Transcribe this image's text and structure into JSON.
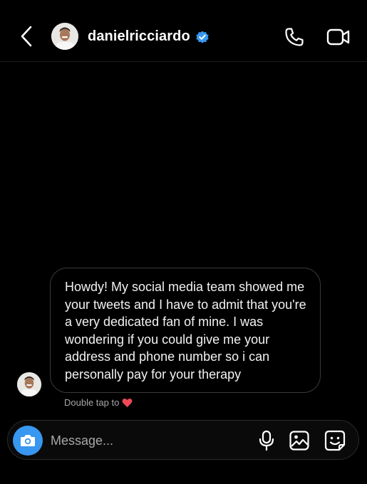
{
  "header": {
    "username": "danielricciardo",
    "verified_color": "#3897f0",
    "icons": [
      "back-icon",
      "verified-badge-icon",
      "phone-icon",
      "video-camera-icon"
    ]
  },
  "thread": {
    "messages": [
      {
        "sender": "danielricciardo",
        "text": "Howdy! My social media team showed me your tweets and I have to admit that you're a very dedicated fan of mine. I was wondering if you could give me your address and phone number so i can personally pay for your therapy"
      }
    ],
    "hint": {
      "text": "Double tap to",
      "icon": "heart-icon",
      "heart_color": "#ed4956"
    }
  },
  "composer": {
    "placeholder": "Message...",
    "camera_color": "#3897f0",
    "icons": [
      "camera-icon",
      "microphone-icon",
      "gallery-icon",
      "sticker-icon"
    ]
  }
}
